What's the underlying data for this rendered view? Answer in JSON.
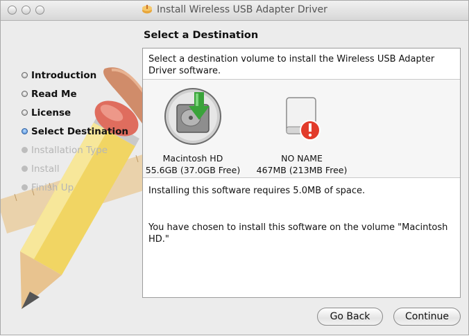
{
  "window": {
    "title": "Install Wireless USB Adapter Driver"
  },
  "steps": [
    {
      "label": "Introduction",
      "state": "done"
    },
    {
      "label": "Read Me",
      "state": "done"
    },
    {
      "label": "License",
      "state": "done"
    },
    {
      "label": "Select Destination",
      "state": "current"
    },
    {
      "label": "Installation Type",
      "state": "future"
    },
    {
      "label": "Install",
      "state": "future"
    },
    {
      "label": "Finish Up",
      "state": "future"
    }
  ],
  "main": {
    "heading": "Select a Destination",
    "intro": "Select a destination volume to install the Wireless USB Adapter Driver software.",
    "volumes": [
      {
        "name": "Macintosh HD",
        "size": "55.6GB (37.0GB Free)",
        "icon": "hard-drive-install-icon",
        "selected": true
      },
      {
        "name": "NO NAME",
        "size": "467MB (213MB Free)",
        "icon": "external-drive-error-icon",
        "selected": false
      }
    ],
    "requirement": "Installing this software requires 5.0MB of space.",
    "chosen": "You have chosen to install this software on the volume \"Macintosh HD.\""
  },
  "buttons": {
    "back": "Go Back",
    "continue": "Continue"
  },
  "colors": {
    "accent": "#3e7fd4",
    "alert": "#e23b2b",
    "install_arrow": "#3aa33a"
  }
}
